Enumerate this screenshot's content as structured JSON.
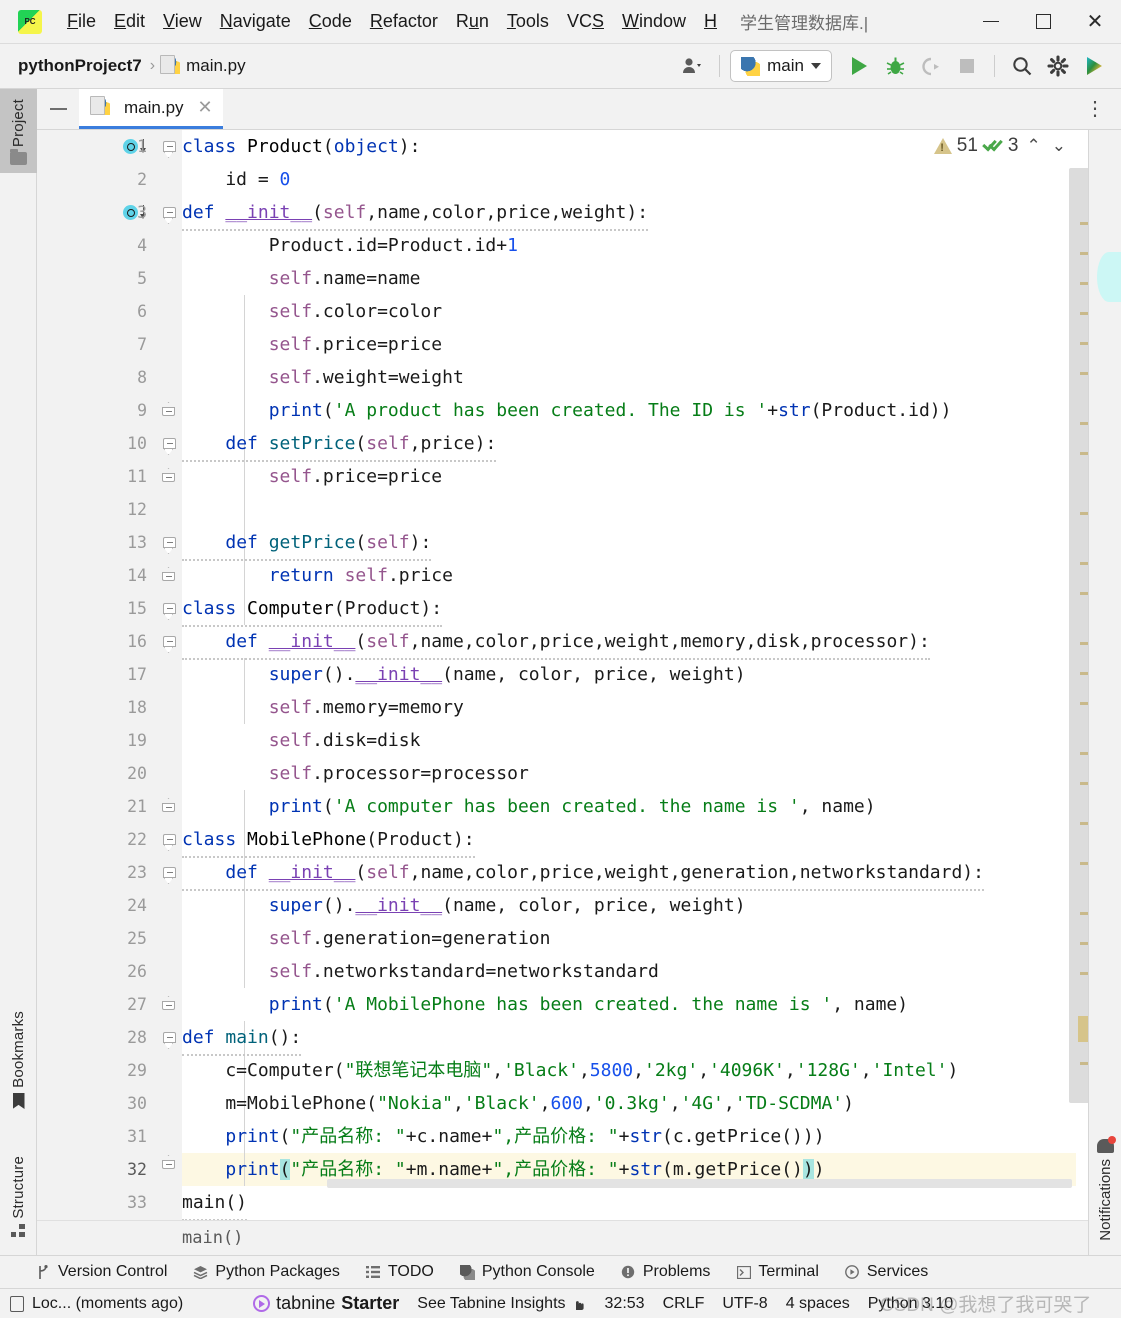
{
  "window": {
    "title": "学生管理数据库.|",
    "minimize_label": "−",
    "maximize_label": "□",
    "close_label": "✕"
  },
  "menubar": {
    "items": [
      {
        "label": "File",
        "mnemonic": "F"
      },
      {
        "label": "Edit",
        "mnemonic": "E"
      },
      {
        "label": "View",
        "mnemonic": "V"
      },
      {
        "label": "Navigate",
        "mnemonic": "N"
      },
      {
        "label": "Code",
        "mnemonic": "C"
      },
      {
        "label": "Refactor",
        "mnemonic": "R"
      },
      {
        "label": "Run",
        "mnemonic": "u"
      },
      {
        "label": "Tools",
        "mnemonic": "T"
      },
      {
        "label": "VCS",
        "mnemonic": "S"
      },
      {
        "label": "Window",
        "mnemonic": "W"
      },
      {
        "label": "H",
        "mnemonic": "H"
      }
    ]
  },
  "navbar": {
    "project": "pythonProject7",
    "separator": "›",
    "file": "main.py",
    "run_config": "main",
    "icons": [
      "account-icon",
      "run-icon",
      "debug-icon",
      "run-with-coverage-icon",
      "stop-icon",
      "search-icon",
      "settings-gear-icon",
      "ai-assistant-icon"
    ]
  },
  "left_tool_strip": {
    "tabs": [
      {
        "label": "Project",
        "icon": "folder-icon",
        "active": true
      },
      {
        "label": "Bookmarks",
        "icon": "bookmark-icon",
        "active": false
      },
      {
        "label": "Structure",
        "icon": "structure-icon",
        "active": false
      }
    ]
  },
  "right_tool_strip": {
    "tabs": [
      {
        "label": "Notifications",
        "icon": "bell-icon",
        "active": false
      }
    ]
  },
  "editor": {
    "tab": {
      "label": "main.py",
      "icon": "python-file-icon",
      "close": "✕",
      "active": true
    },
    "more_label": "⋮",
    "breadcrumb": "main()",
    "inspections": {
      "warning_count": "51",
      "ok_count": "3",
      "prev_label": "⌃",
      "next_label": "⌄"
    },
    "current_line": 32,
    "lines": [
      {
        "n": "1",
        "gutter_icon": "override-run-icon",
        "fold": "start"
      },
      {
        "n": "2",
        "gutter_icon": "",
        "fold": ""
      },
      {
        "n": "3",
        "gutter_icon": "override-run-icon",
        "fold": "start"
      },
      {
        "n": "4",
        "gutter_icon": "",
        "fold": ""
      },
      {
        "n": "5",
        "gutter_icon": "",
        "fold": ""
      },
      {
        "n": "6",
        "gutter_icon": "",
        "fold": ""
      },
      {
        "n": "7",
        "gutter_icon": "",
        "fold": ""
      },
      {
        "n": "8",
        "gutter_icon": "",
        "fold": ""
      },
      {
        "n": "9",
        "gutter_icon": "",
        "fold": "end"
      },
      {
        "n": "10",
        "gutter_icon": "",
        "fold": "start"
      },
      {
        "n": "11",
        "gutter_icon": "",
        "fold": "end"
      },
      {
        "n": "12",
        "gutter_icon": "",
        "fold": ""
      },
      {
        "n": "13",
        "gutter_icon": "",
        "fold": "start"
      },
      {
        "n": "14",
        "gutter_icon": "",
        "fold": "end"
      },
      {
        "n": "15",
        "gutter_icon": "",
        "fold": "start"
      },
      {
        "n": "16",
        "gutter_icon": "",
        "fold": "start"
      },
      {
        "n": "17",
        "gutter_icon": "",
        "fold": ""
      },
      {
        "n": "18",
        "gutter_icon": "",
        "fold": ""
      },
      {
        "n": "19",
        "gutter_icon": "",
        "fold": ""
      },
      {
        "n": "20",
        "gutter_icon": "",
        "fold": ""
      },
      {
        "n": "21",
        "gutter_icon": "",
        "fold": "end"
      },
      {
        "n": "22",
        "gutter_icon": "",
        "fold": "start"
      },
      {
        "n": "23",
        "gutter_icon": "",
        "fold": "start"
      },
      {
        "n": "24",
        "gutter_icon": "",
        "fold": ""
      },
      {
        "n": "25",
        "gutter_icon": "",
        "fold": ""
      },
      {
        "n": "26",
        "gutter_icon": "",
        "fold": ""
      },
      {
        "n": "27",
        "gutter_icon": "",
        "fold": "end"
      },
      {
        "n": "28",
        "gutter_icon": "",
        "fold": "start"
      },
      {
        "n": "29",
        "gutter_icon": "",
        "fold": ""
      },
      {
        "n": "30",
        "gutter_icon": "",
        "fold": ""
      },
      {
        "n": "31",
        "gutter_icon": "",
        "fold": ""
      },
      {
        "n": "32",
        "gutter_icon": "",
        "fold": "end"
      },
      {
        "n": "33",
        "gutter_icon": "",
        "fold": ""
      }
    ],
    "source_code": [
      "class Product(object):",
      "    id = 0",
      "    def __init__(self,name,color,price,weight):",
      "        Product.id=Product.id+1",
      "        self.name=name",
      "        self.color=color",
      "        self.price=price",
      "        self.weight=weight",
      "        print('A product has been created. The ID is '+str(Product.id))",
      "    def setPrice(self,price):",
      "        self.price=price",
      "",
      "    def getPrice(self):",
      "        return self.price",
      "class Computer(Product):",
      "    def __init__(self,name,color,price,weight,memory,disk,processor):",
      "        super().__init__(name, color, price, weight)",
      "        self.memory=memory",
      "        self.disk=disk",
      "        self.processor=processor",
      "        print('A computer has been created. the name is ', name)",
      "class MobilePhone(Product):",
      "    def __init__(self,name,color,price,weight,generation,networkstandard):",
      "        super().__init__(name, color, price, weight)",
      "        self.generation=generation",
      "        self.networkstandard=networkstandard",
      "        print('A MobilePhone has been created. the name is ', name)",
      "def main():",
      "    c=Computer(\"联想笔记本电脑\",'Black',5800,'2kg','4096K','128G','Intel')",
      "    m=MobilePhone(\"Nokia\",'Black',600,'0.3kg','4G','TD-SCDMA')",
      "    print(\"产品名称: \"+c.name+\",产品价格: \"+str(c.getPrice()))",
      "    print(\"产品名称: \"+m.name+\",产品价格: \"+str(m.getPrice()))",
      "main()"
    ]
  },
  "bottom_bar": {
    "items": [
      {
        "label": "Version Control",
        "icon": "branch-icon"
      },
      {
        "label": "Python Packages",
        "icon": "layers-icon"
      },
      {
        "label": "TODO",
        "icon": "list-icon"
      },
      {
        "label": "Python Console",
        "icon": "python-icon"
      },
      {
        "label": "Problems",
        "icon": "exclamation-icon"
      },
      {
        "label": "Terminal",
        "icon": "terminal-icon"
      },
      {
        "label": "Services",
        "icon": "services-icon"
      }
    ]
  },
  "status_bar": {
    "location": "Loc... (moments ago)",
    "tabnine_brand": "tabnine",
    "tabnine_suffix": "Starter",
    "tabnine_insights": "See Tabnine Insights",
    "caret_position": "32:53",
    "line_separator": "CRLF",
    "encoding": "UTF-8",
    "indent": "4 spaces",
    "interpreter": "Python 3.10",
    "watermark": "CSDN @我想了我可哭了"
  },
  "colors": {
    "accent_blue": "#3b7ddd",
    "keyword": "#0033b3",
    "string": "#067d17",
    "number": "#1750eb",
    "self": "#94558d",
    "function": "#00627a",
    "warning": "#d6c48a",
    "ok_green": "#4aa84a",
    "current_line_bg": "#fdf8e3",
    "match_highlight": "#a8e5e0"
  }
}
